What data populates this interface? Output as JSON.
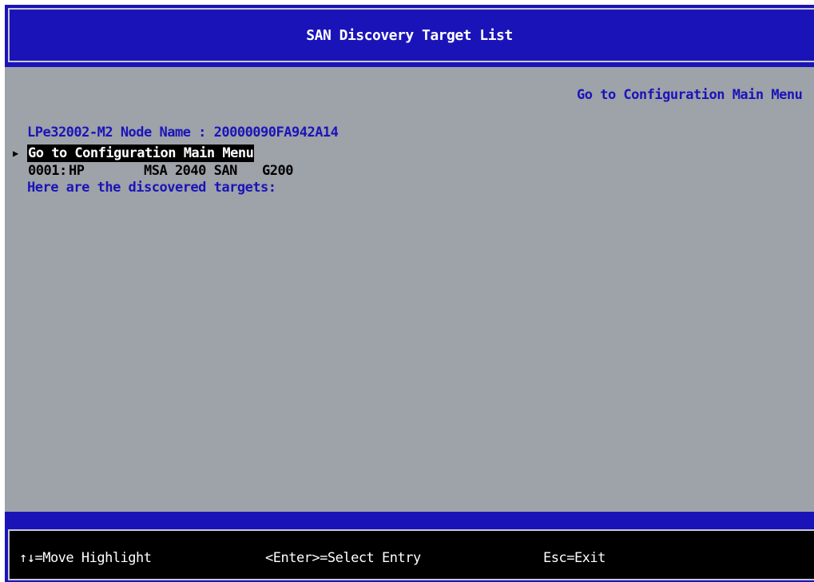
{
  "title": "SAN Discovery Target List",
  "info": {
    "node_line": "LPe32002-M2 Node Name : 20000090FA942A14",
    "subtitle": "Here are the discovered targets:",
    "help_text": "Go to Configuration Main Menu"
  },
  "menu": {
    "items": [
      {
        "pointer": "▶",
        "label": "Go to Configuration Main Menu"
      }
    ],
    "targets": [
      {
        "id": "0001:",
        "vendor": "HP",
        "product": "MSA 2040 SAN",
        "revision": "G200"
      }
    ]
  },
  "footer": {
    "move_hint": "↑↓=Move Highlight",
    "enter_hint": "<Enter>=Select Entry",
    "esc_hint": "Esc=Exit"
  },
  "colors": {
    "bar": "#1a14b8",
    "background": "#9ea2a9",
    "text_blue": "#1a14b8",
    "highlight": "#000000"
  }
}
